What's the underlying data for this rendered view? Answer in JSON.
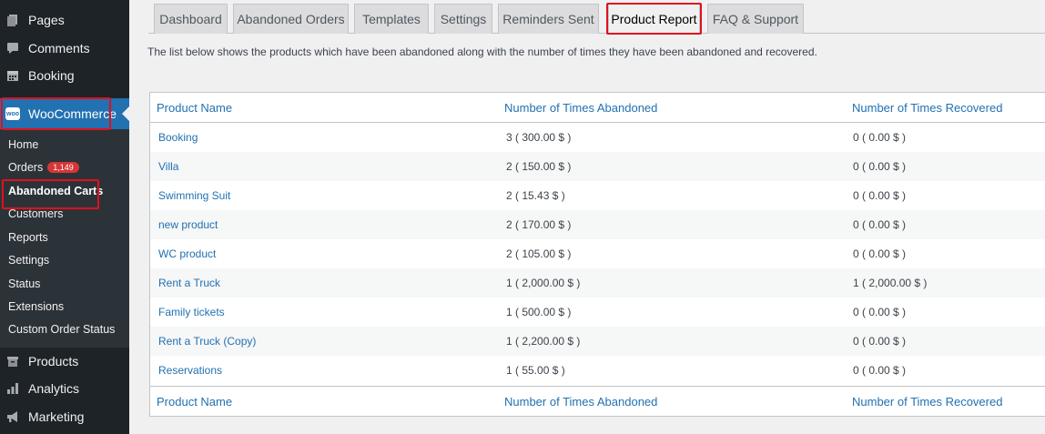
{
  "sidebar": {
    "top_items": [
      {
        "label": "Pages",
        "icon": "pages-icon"
      },
      {
        "label": "Comments",
        "icon": "comments-icon"
      },
      {
        "label": "Booking",
        "icon": "booking-icon"
      }
    ],
    "woocommerce": {
      "label": "WooCommerce",
      "logo_text": "woo"
    },
    "submenu": [
      {
        "label": "Home"
      },
      {
        "label": "Orders",
        "badge": "1,149"
      },
      {
        "label": "Abandoned Carts",
        "current": true
      },
      {
        "label": "Customers"
      },
      {
        "label": "Reports"
      },
      {
        "label": "Settings"
      },
      {
        "label": "Status"
      },
      {
        "label": "Extensions"
      },
      {
        "label": "Custom Order Status"
      }
    ],
    "bottom_items": [
      {
        "label": "Products",
        "icon": "products-icon"
      },
      {
        "label": "Analytics",
        "icon": "analytics-icon"
      },
      {
        "label": "Marketing",
        "icon": "marketing-icon"
      }
    ]
  },
  "tabs": [
    {
      "label": "Dashboard"
    },
    {
      "label": "Abandoned Orders"
    },
    {
      "label": "Templates"
    },
    {
      "label": "Settings"
    },
    {
      "label": "Reminders Sent"
    },
    {
      "label": "Product Report",
      "active": true
    },
    {
      "label": "FAQ & Support"
    }
  ],
  "intro_text": "The list below shows the products which have been abandoned along with the number of times they have been abandoned and recovered.",
  "table": {
    "columns": [
      "Product Name",
      "Number of Times Abandoned",
      "Number of Times Recovered"
    ],
    "rows": [
      {
        "name": "Booking",
        "abandoned": "3 ( 300.00 $ )",
        "recovered": "0 ( 0.00 $ )"
      },
      {
        "name": "Villa",
        "abandoned": "2 ( 150.00 $ )",
        "recovered": "0 ( 0.00 $ )"
      },
      {
        "name": "Swimming Suit",
        "abandoned": "2 ( 15.43 $ )",
        "recovered": "0 ( 0.00 $ )"
      },
      {
        "name": "new product",
        "abandoned": "2 ( 170.00 $ )",
        "recovered": "0 ( 0.00 $ )"
      },
      {
        "name": "WC product",
        "abandoned": "2 ( 105.00 $ )",
        "recovered": "0 ( 0.00 $ )"
      },
      {
        "name": "Rent a Truck",
        "abandoned": "1 ( 2,000.00 $ )",
        "recovered": "1 ( 2,000.00 $ )"
      },
      {
        "name": "Family tickets",
        "abandoned": "1 ( 500.00 $ )",
        "recovered": "0 ( 0.00 $ )"
      },
      {
        "name": "Rent a Truck (Copy)",
        "abandoned": "1 ( 2,200.00 $ )",
        "recovered": "0 ( 0.00 $ )"
      },
      {
        "name": "Reservations",
        "abandoned": "1 ( 55.00 $ )",
        "recovered": "0 ( 0.00 $ )"
      }
    ]
  },
  "colors": {
    "sidebar_bg": "#1d2327",
    "submenu_bg": "#2c3338",
    "accent": "#2271b1",
    "highlight": "#e0101e",
    "badge": "#d63638"
  }
}
